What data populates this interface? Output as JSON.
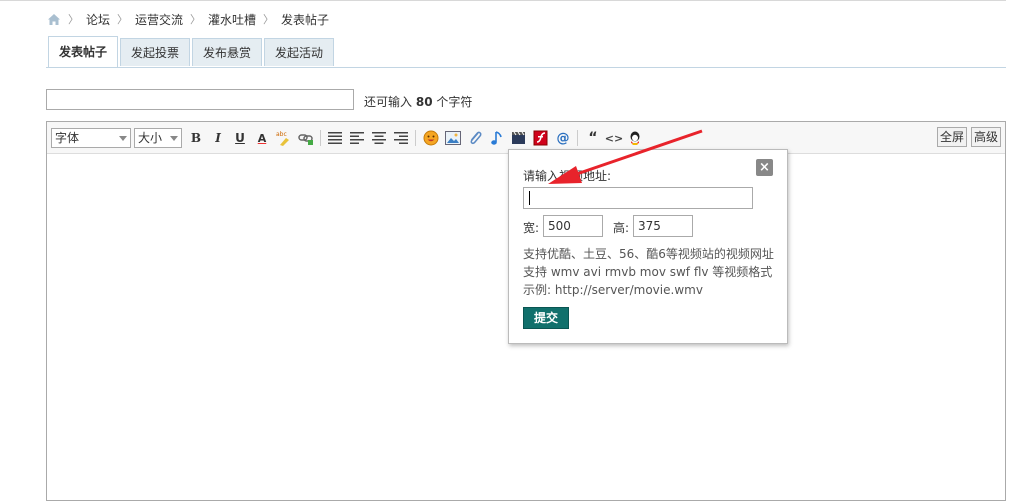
{
  "breadcrumb": {
    "items": [
      "论坛",
      "运营交流",
      "灌水吐槽",
      "发表帖子"
    ]
  },
  "tabs": [
    {
      "label": "发表帖子",
      "active": true
    },
    {
      "label": "发起投票",
      "active": false
    },
    {
      "label": "发布悬赏",
      "active": false
    },
    {
      "label": "发起活动",
      "active": false
    }
  ],
  "subject": {
    "value": "",
    "hint_prefix": "还可输入",
    "hint_count": "80",
    "hint_suffix": "个字符"
  },
  "toolbar": {
    "font_select": "字体",
    "size_select": "大小",
    "bold": "B",
    "italic": "I",
    "underline": "U",
    "font_color": "A",
    "quote": "“",
    "code": "<>",
    "fullscreen": "全屏",
    "advanced": "高级",
    "icons": [
      "bold-icon",
      "italic-icon",
      "underline-icon",
      "font-color-icon",
      "highlight-icon",
      "link-icon",
      "align-justify-icon",
      "align-left-icon",
      "align-center-icon",
      "align-right-icon",
      "emoji-icon",
      "image-icon",
      "attachment-icon",
      "audio-icon",
      "video-icon",
      "flash-icon",
      "mention-icon",
      "quote-icon",
      "code-icon",
      "qq-icon"
    ]
  },
  "video_popup": {
    "title": "请输入视频地址:",
    "url_value": "",
    "width_label": "宽:",
    "width_value": "500",
    "height_label": "高:",
    "height_value": "375",
    "info_lines": [
      "支持优酷、土豆、56、酷6等视频站的视频网址",
      "支持 wmv avi rmvb mov swf flv 等视频格式",
      "示例: http://server/movie.wmv"
    ],
    "submit_label": "提交",
    "close_label": "×"
  },
  "colors": {
    "tab_bg": "#e5edf2",
    "tab_border": "#c2d5e3",
    "submit_bg": "#11706c",
    "annotation_arrow": "#e8232b"
  }
}
